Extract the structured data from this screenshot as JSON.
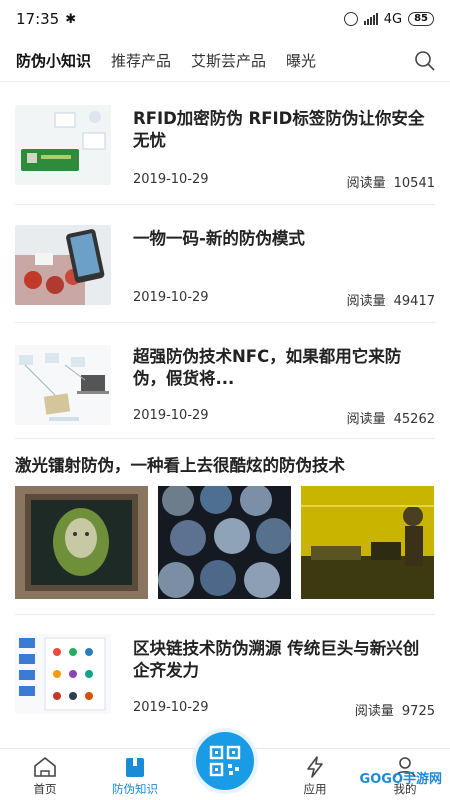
{
  "status_bar": {
    "time": "17:35",
    "network": "4G",
    "battery": "85"
  },
  "tabs": [
    {
      "label": "防伪小知识",
      "active": true
    },
    {
      "label": "推荐产品",
      "active": false
    },
    {
      "label": "艾斯芸产品",
      "active": false
    },
    {
      "label": "曝光",
      "active": false
    }
  ],
  "articles": [
    {
      "title": "RFID加密防伪 RFID标签防伪让你安全无忧",
      "date": "2019-10-29",
      "reads_label": "阅读量",
      "reads": "10541"
    },
    {
      "title": "一物一码-新的防伪模式",
      "date": "2019-10-29",
      "reads_label": "阅读量",
      "reads": "49417"
    },
    {
      "title": "超强防伪技术NFC，如果都用它来防伪，假货将...",
      "date": "2019-10-29",
      "reads_label": "阅读量",
      "reads": "45262"
    }
  ],
  "feature": {
    "title": "激光镭射防伪，一种看上去很酷炫的防伪技术"
  },
  "article4": {
    "title": "区块链技术防伪溯源 传统巨头与新兴创企齐发力",
    "date": "2019-10-29",
    "reads_label": "阅读量",
    "reads": "9725"
  },
  "bottom_nav": {
    "home": "首页",
    "knowledge": "防伪知识",
    "apps": "应用",
    "mine": "我的"
  },
  "watermark": "GOGO手游网",
  "colors": {
    "accent": "#1a9be6",
    "active_nav": "#1a8bd6"
  }
}
